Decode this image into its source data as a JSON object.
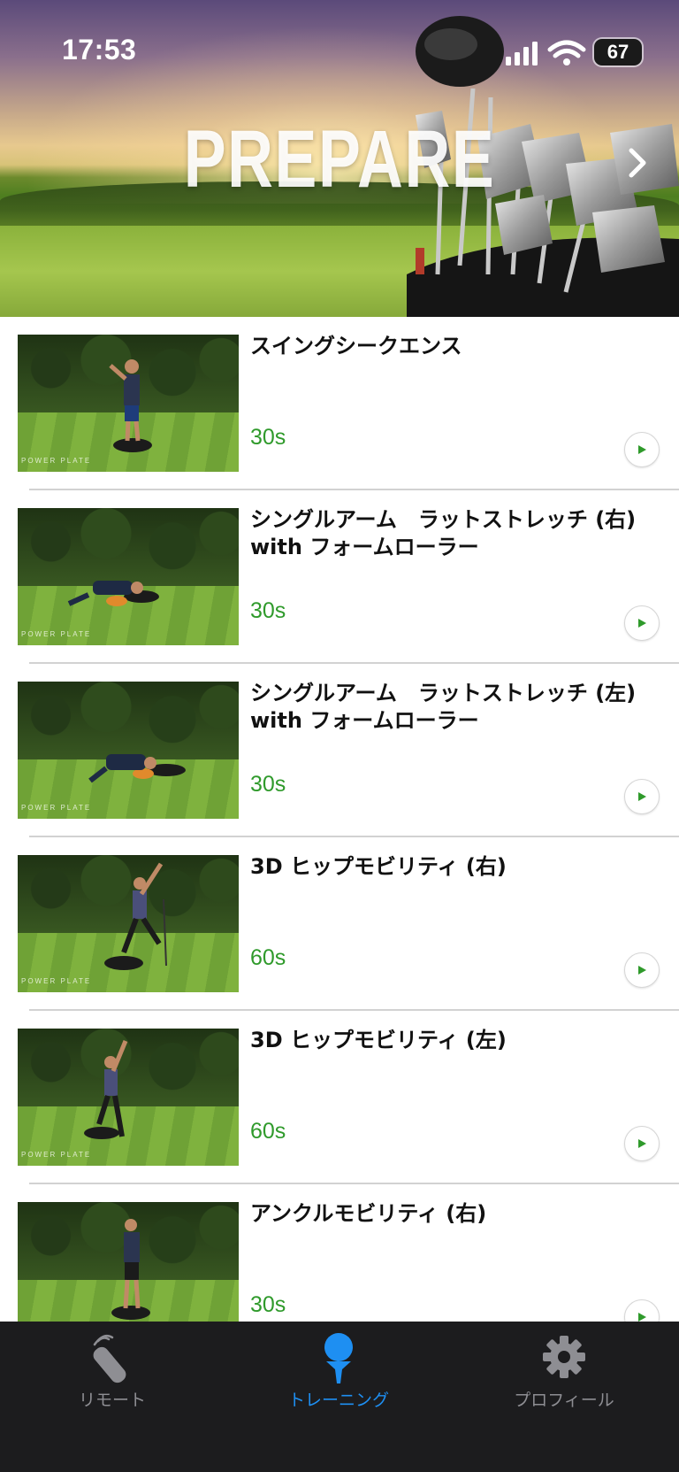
{
  "status_bar": {
    "time": "17:53",
    "battery": "67"
  },
  "hero": {
    "title": "PREPARE"
  },
  "exercises": [
    {
      "title": "スイングシークエンス",
      "duration": "30s"
    },
    {
      "title": "シングルアーム　ラットストレッチ (右) with フォームローラー",
      "duration": "30s"
    },
    {
      "title": "シングルアーム　ラットストレッチ (左) with フォームローラー",
      "duration": "30s"
    },
    {
      "title": "3D ヒップモビリティ (右)",
      "duration": "60s"
    },
    {
      "title": "3D ヒップモビリティ (左)",
      "duration": "60s"
    },
    {
      "title": "アンクルモビリティ (右)",
      "duration": "30s"
    }
  ],
  "thumbnail_brand": "POWER PLATE",
  "tab_bar": {
    "tabs": [
      {
        "label": "リモート",
        "icon": "remote-icon",
        "active": false
      },
      {
        "label": "トレーニング",
        "icon": "golf-tee-icon",
        "active": true
      },
      {
        "label": "プロフィール",
        "icon": "gear-icon",
        "active": false
      }
    ]
  },
  "colors": {
    "duration": "#2f9a2b",
    "active_tab": "#1e8ff2",
    "tab_bar_bg": "#1c1c1e"
  }
}
